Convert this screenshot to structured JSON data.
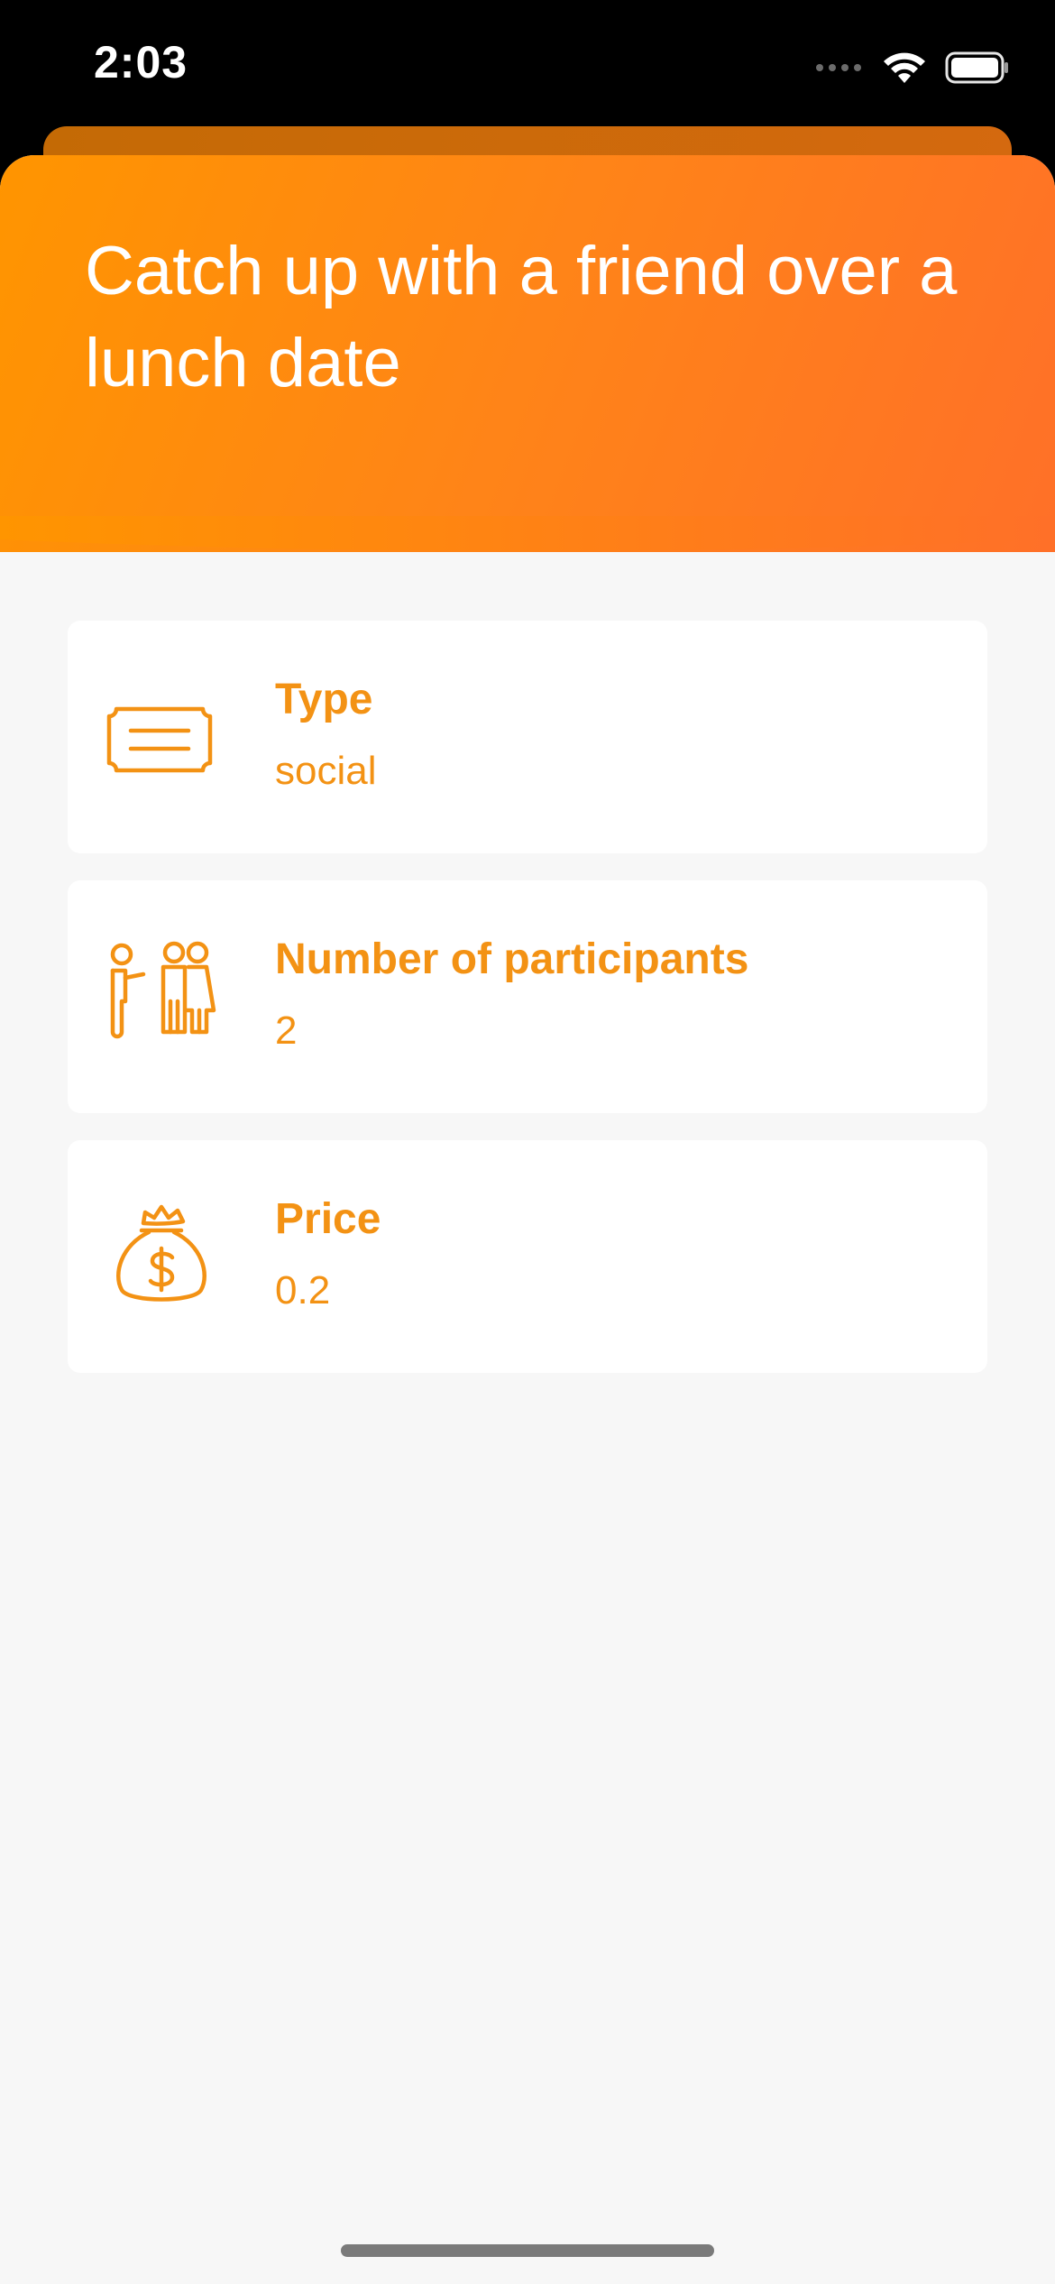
{
  "status_bar": {
    "time": "2:03"
  },
  "activity": {
    "title": "Catch up with a friend over a lunch date"
  },
  "details": [
    {
      "label": "Type",
      "value": "social",
      "icon": "ticket-icon"
    },
    {
      "label": "Number of participants",
      "value": "2",
      "icon": "participants-icon"
    },
    {
      "label": "Price",
      "value": "0.2",
      "icon": "money-bag-icon"
    }
  ],
  "colors": {
    "accent": "#f39214",
    "header_gradient_start": "#ff9500",
    "header_gradient_end": "#ff7028",
    "background": "#f7f7f7",
    "card": "#ffffff"
  }
}
